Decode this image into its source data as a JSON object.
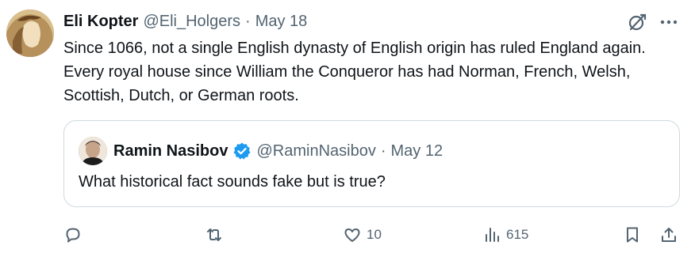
{
  "tweet": {
    "author_name": "Eli Kopter",
    "author_handle": "@Eli_Holgers",
    "separator": "·",
    "date": "May 18",
    "text": "Since 1066, not a single English dynasty of English origin has ruled England again. Every royal house since William the Conqueror has had Norman, French, Welsh, Scottish, Dutch, or German roots."
  },
  "quote": {
    "author_name": "Ramin Nasibov",
    "author_handle": "@RaminNasibov",
    "separator": "·",
    "date": "May 12",
    "verified": true,
    "text": "What historical fact sounds fake but is true?"
  },
  "actions": {
    "reply_count": "",
    "repost_count": "",
    "like_count": "10",
    "view_count": "615"
  },
  "icons": {
    "header": [
      "grok-icon",
      "more-icon"
    ],
    "actions": [
      "reply-icon",
      "repost-icon",
      "like-icon",
      "views-icon",
      "bookmark-icon",
      "share-icon"
    ],
    "verified": "verified-badge-icon"
  },
  "colors": {
    "text_primary": "#0f1419",
    "text_secondary": "#536471",
    "border": "#cfd9de",
    "verified_blue": "#1d9bf0"
  }
}
